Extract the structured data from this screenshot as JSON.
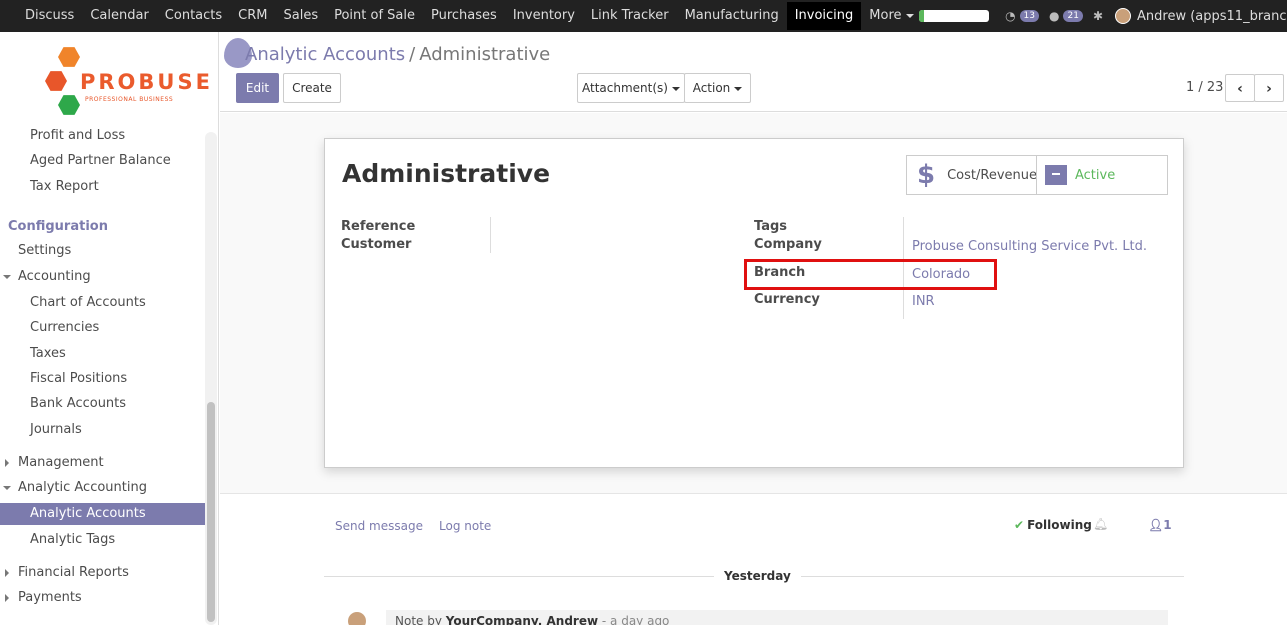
{
  "navbar": {
    "menu": [
      "Discuss",
      "Calendar",
      "Contacts",
      "CRM",
      "Sales",
      "Point of Sale",
      "Purchases",
      "Inventory",
      "Link Tracker",
      "Manufacturing",
      "Invoicing",
      "More"
    ],
    "active_menu": "Invoicing",
    "progress_fraction": 0.07,
    "activity_count": "13",
    "message_count": "21",
    "user": "Andrew (apps11_branc..."
  },
  "logo": {
    "name": "PROBUSE",
    "tagline": "PROFESSIONAL BUSINESS"
  },
  "sidebar": {
    "reporting": [
      "Profit and Loss",
      "Aged Partner Balance",
      "Tax Report"
    ],
    "config_header": "Configuration",
    "settings": "Settings",
    "accounting": "Accounting",
    "accounting_items": [
      "Chart of Accounts",
      "Currencies",
      "Taxes",
      "Fiscal Positions",
      "Bank Accounts",
      "Journals"
    ],
    "management": "Management",
    "analytic_accounting": "Analytic Accounting",
    "analytic_items": [
      "Analytic Accounts",
      "Analytic Tags"
    ],
    "selected": "Analytic Accounts",
    "financial_reports": "Financial Reports",
    "payments": "Payments"
  },
  "control_panel": {
    "breadcrumb_parent": "Analytic Accounts",
    "breadcrumb_sep": "/",
    "breadcrumb_current": "Administrative",
    "edit_label": "Edit",
    "create_label": "Create",
    "attachments_label": "Attachment(s)",
    "action_label": "Action",
    "pager": "1 / 23",
    "prev_icon": "chevron-left-icon",
    "next_icon": "chevron-right-icon"
  },
  "form": {
    "title": "Administrative",
    "cost_revenue_label": "Cost/Revenue",
    "active_label": "Active",
    "labels": {
      "reference": "Reference",
      "customer": "Customer",
      "tags": "Tags",
      "company": "Company",
      "branch": "Branch",
      "currency": "Currency"
    },
    "values": {
      "company": "Probuse Consulting Service Pvt. Ltd.",
      "branch": "Colorado",
      "currency": "INR"
    }
  },
  "chatter": {
    "send_message": "Send message",
    "log_note": "Log note",
    "following": "Following",
    "followers_count": "1",
    "day_separator": "Yesterday",
    "note_prefix": "Note by",
    "note_author": "YourCompany, Andrew",
    "note_time": "- a day ago"
  },
  "colors": {
    "accent": "#7c7bad",
    "navbar": "#222222",
    "highlight": "#e01010",
    "active_green": "#5cb85c"
  }
}
